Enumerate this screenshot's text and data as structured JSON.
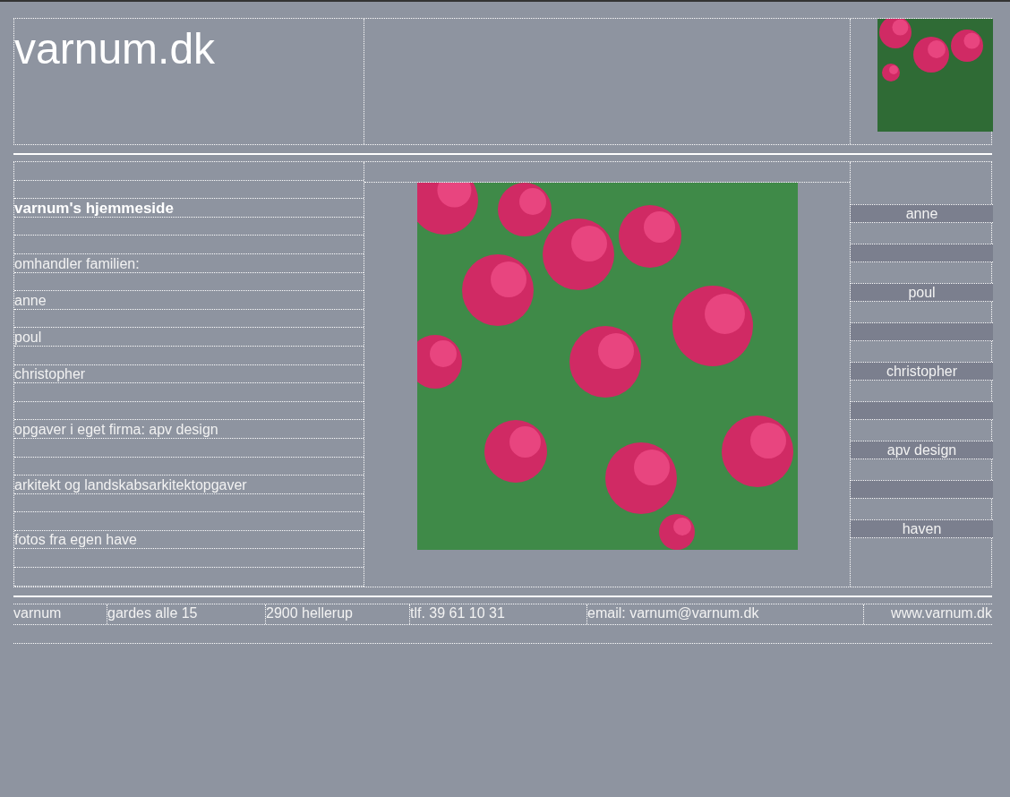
{
  "header": {
    "title": "varnum.dk"
  },
  "intro": [
    {
      "kind": "heading",
      "text": "varnum's hjemmeside"
    },
    {
      "kind": "text",
      "text": "omhandler familien:"
    },
    {
      "kind": "text",
      "text": "anne"
    },
    {
      "kind": "text",
      "text": "poul"
    },
    {
      "kind": "text",
      "text": "christopher"
    },
    {
      "kind": "text",
      "text": "opgaver i eget firma: apv design"
    },
    {
      "kind": "text",
      "text": "arkitekt og landskabsarkitektopgaver"
    },
    {
      "kind": "text",
      "text": "fotos fra egen have"
    }
  ],
  "nav": [
    {
      "label": "anne"
    },
    {
      "label": "poul"
    },
    {
      "label": "christopher"
    },
    {
      "label": "apv design"
    },
    {
      "label": "haven"
    }
  ],
  "footer": {
    "cells": [
      "varnum",
      "gardes alle 15",
      "2900 hellerup",
      "tlf. 39 61 10 31",
      "email: varnum@varnum.dk",
      "www.varnum.dk"
    ]
  }
}
